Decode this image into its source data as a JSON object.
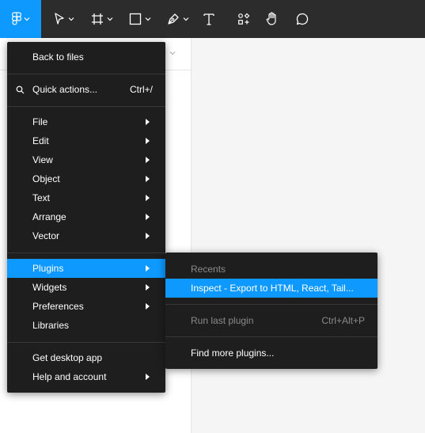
{
  "toolbar": {
    "tools": [
      {
        "name": "main-menu-button",
        "icon": "figma-logo-icon"
      },
      {
        "name": "move-tool",
        "icon": "cursor-icon"
      },
      {
        "name": "frame-tool",
        "icon": "frame-hash-icon"
      },
      {
        "name": "shape-tool",
        "icon": "rectangle-icon"
      },
      {
        "name": "pen-tool",
        "icon": "pen-icon"
      },
      {
        "name": "text-tool",
        "icon": "text-icon"
      },
      {
        "name": "resources-tool",
        "icon": "resources-icon"
      },
      {
        "name": "hand-tool",
        "icon": "hand-icon"
      },
      {
        "name": "comment-tool",
        "icon": "comment-bubble-icon"
      }
    ],
    "accent": "#0d99ff",
    "background": "#2c2c2c"
  },
  "menu": {
    "back_to_files": "Back to files",
    "quick_actions": "Quick actions...",
    "quick_actions_shortcut": "Ctrl+/",
    "items_group1": [
      "File",
      "Edit",
      "View",
      "Object",
      "Text",
      "Arrange",
      "Vector"
    ],
    "items_group2": [
      "Plugins",
      "Widgets",
      "Preferences",
      "Libraries"
    ],
    "items_group3": [
      "Get desktop app",
      "Help and account"
    ],
    "background": "#1e1e1e"
  },
  "submenu": {
    "recents_header": "Recents",
    "recent_plugin": "Inspect - Export to HTML, React, Tail...",
    "run_last": "Run last plugin",
    "run_last_shortcut": "Ctrl+Alt+P",
    "find_more": "Find more plugins..."
  }
}
